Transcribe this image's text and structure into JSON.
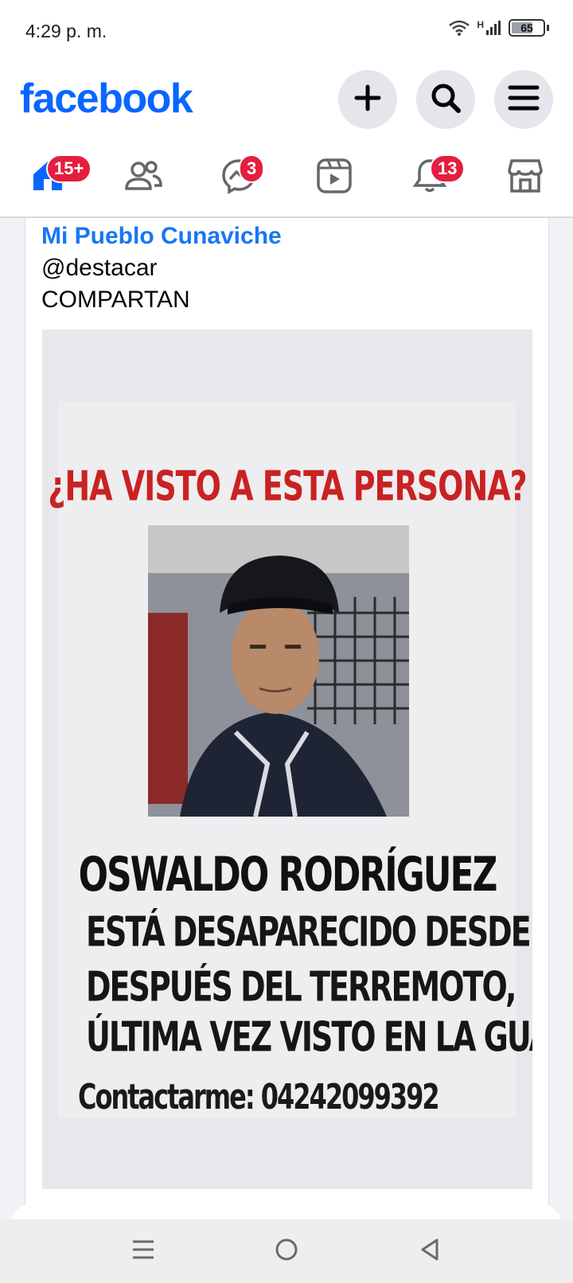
{
  "status_bar": {
    "time": "4:29 p. m.",
    "network_label": "H",
    "battery": "65"
  },
  "header": {
    "logo": "facebook",
    "icons": [
      "plus-icon",
      "search-icon",
      "menu-icon"
    ]
  },
  "nav": {
    "tabs": [
      {
        "name": "home",
        "icon": "home-icon",
        "badge": "15+"
      },
      {
        "name": "friends",
        "icon": "friends-icon",
        "badge": ""
      },
      {
        "name": "messenger",
        "icon": "messenger-icon",
        "badge": "3"
      },
      {
        "name": "video",
        "icon": "video-icon",
        "badge": ""
      },
      {
        "name": "notifications",
        "icon": "bell-icon",
        "badge": "13"
      },
      {
        "name": "marketplace",
        "icon": "marketplace-icon",
        "badge": ""
      }
    ]
  },
  "post": {
    "author": "Mi Pueblo Cunaviche",
    "lines": [
      "@destacar",
      "COMPARTAN"
    ],
    "poster": {
      "headline": "¿HA VISTO A ESTA PERSONA?",
      "name": "OSWALDO RODRÍGUEZ",
      "body_lines": [
        "ESTÁ DESAPARECIDO DESDE",
        "DESPUÉS DEL TERREMOTO,",
        "ÚLTIMA VEZ VISTO EN LA GUAIRA"
      ],
      "contact": "Contactarme: 04242099392"
    }
  },
  "colors": {
    "brand": "#0866ff",
    "badge": "#e41e3f",
    "author_link": "#1877f2",
    "poster_headline": "#c92222"
  }
}
